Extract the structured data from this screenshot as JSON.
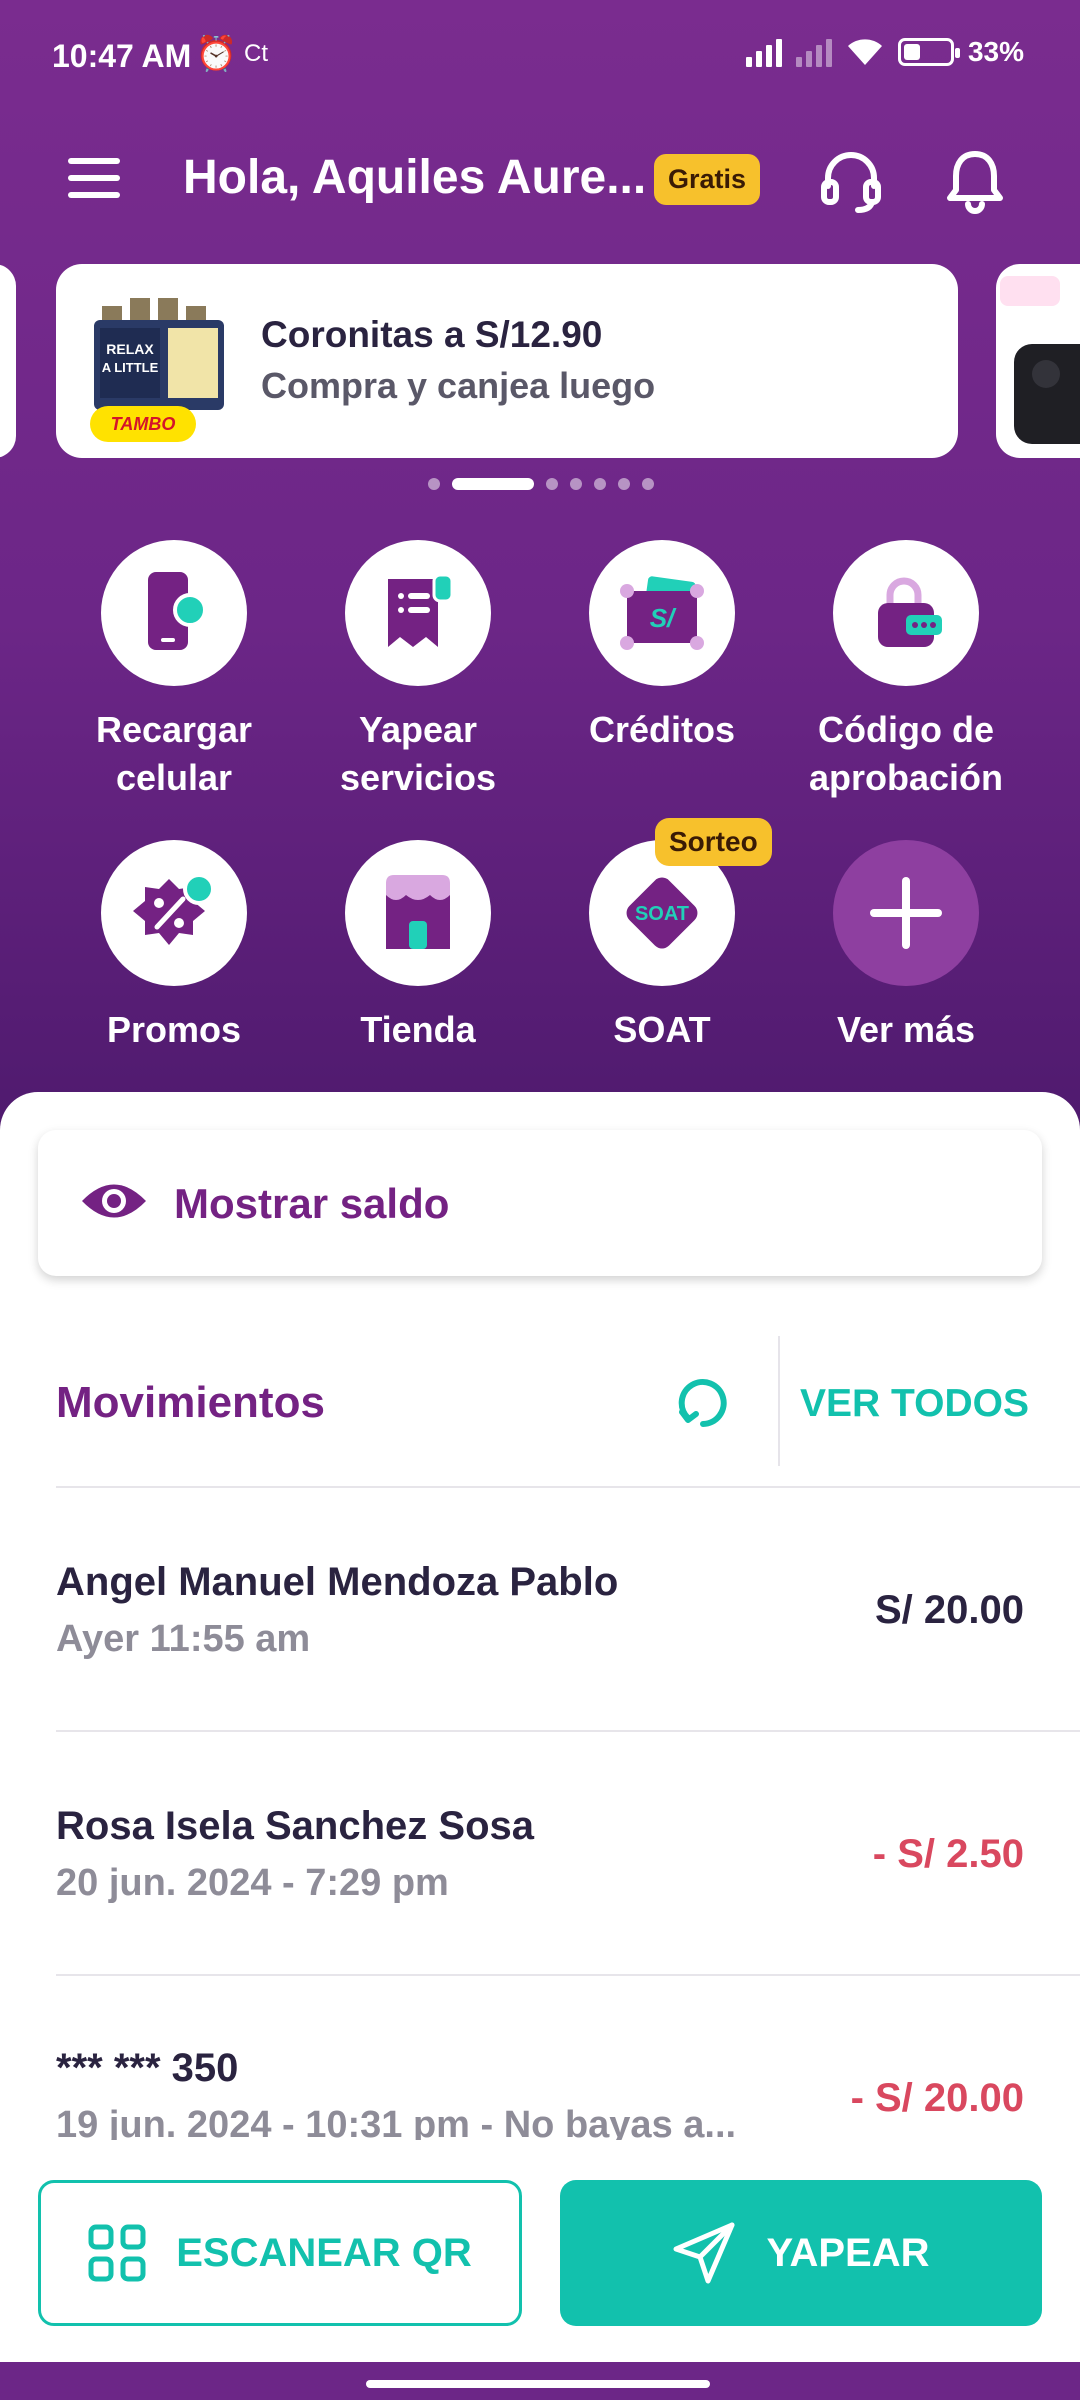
{
  "status_bar": {
    "time": "10:47 AM",
    "carrier_tag": "Ct",
    "battery": "33%",
    "battery_level": 0.33
  },
  "header": {
    "greeting": "Hola, Aquiles Aure...",
    "plan_badge": "Gratis",
    "icons": [
      "menu-icon",
      "headset-icon",
      "bell-icon"
    ]
  },
  "promo": {
    "brand": "TAMBO",
    "title": "Coronitas a S/12.90",
    "subtitle": "Compra y canjea luego",
    "active_slide": 2,
    "slide_count": 7
  },
  "actions": [
    {
      "label": "Recargar celular",
      "icon": "phone-recharge-icon"
    },
    {
      "label": "Yapear servicios",
      "icon": "receipt-icon"
    },
    {
      "label": "Créditos",
      "icon": "wallet-soles-icon"
    },
    {
      "label": "Código de aprobación",
      "icon": "lock-code-icon"
    },
    {
      "label": "Promos",
      "icon": "discount-badge-icon"
    },
    {
      "label": "Tienda",
      "icon": "store-icon"
    },
    {
      "label": "SOAT",
      "icon": "soat-icon",
      "badge": "Sorteo",
      "icon_text": "SOAT"
    },
    {
      "label": "Ver más",
      "icon": "plus-icon"
    }
  ],
  "balance": {
    "label": "Mostrar saldo"
  },
  "movements": {
    "title": "Movimientos",
    "view_all": "VER TODOS",
    "items": [
      {
        "name": "Angel Manuel Mendoza Pablo",
        "date": "Ayer 11:55 am",
        "amount": "S/ 20.00",
        "type": "income"
      },
      {
        "name": "Rosa Isela Sanchez Sosa",
        "date": "20 jun. 2024 - 7:29 pm",
        "amount": "- S/ 2.50",
        "type": "expense"
      },
      {
        "name": "*** *** 350",
        "date": "19 jun. 2024 - 10:31 pm - No bayas a...",
        "amount": "- S/ 20.00",
        "type": "expense"
      }
    ]
  },
  "bottom_actions": {
    "scan_label": "ESCANEAR QR",
    "pay_label": "YAPEAR"
  },
  "colors": {
    "brand_purple": "#742283",
    "accent_teal": "#12c1ad",
    "badge_yellow": "#f7c12c",
    "expense_red": "#d9485f"
  }
}
